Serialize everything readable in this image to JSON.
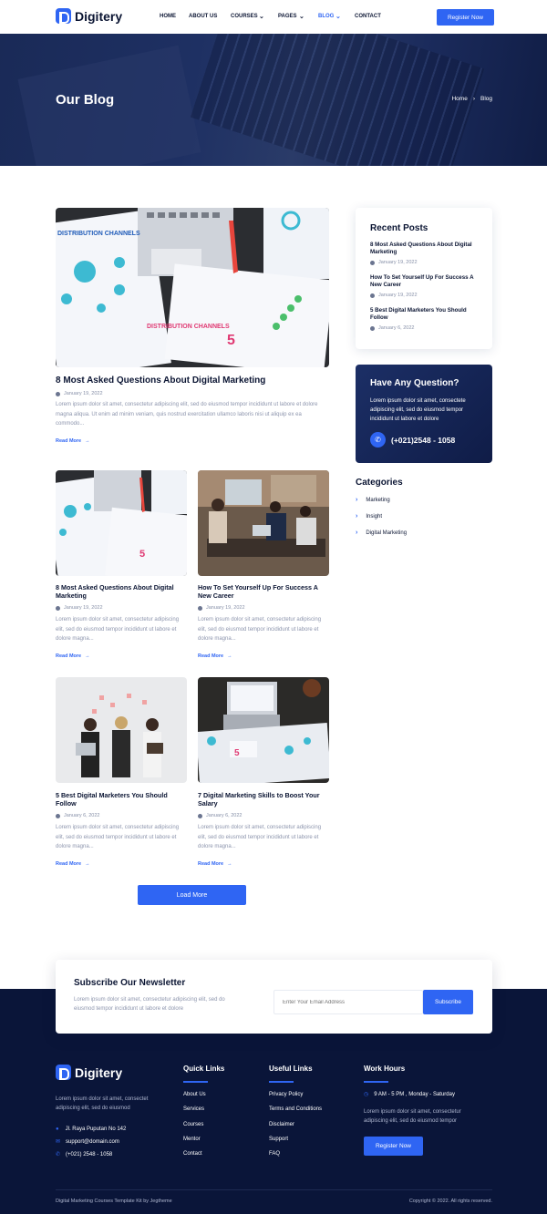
{
  "brand": {
    "name": "Digitery"
  },
  "nav": {
    "items": [
      "HOME",
      "ABOUT US",
      "COURSES",
      "PAGES",
      "BLOG",
      "CONTACT"
    ],
    "cta": "Register Now"
  },
  "hero": {
    "title": "Our Blog",
    "crumb_home": "Home",
    "crumb_current": "Blog"
  },
  "featured": {
    "title": "8 Most Asked Questions About Digital Marketing",
    "date": "January 19, 2022",
    "excerpt": "Lorem ipsum dolor sit amet, consectetur adipiscing elit, sed do eiusmod tempor incididunt ut labore et dolore magna aliqua. Ut enim ad minim veniam, quis nostrud exercitation ullamco laboris nisi ut aliquip ex ea commodo...",
    "read_more": "Read More"
  },
  "posts": [
    {
      "title": "8 Most Asked Questions About Digital Marketing",
      "date": "January 19, 2022",
      "excerpt": "Lorem ipsum dolor sit amet, consectetur adipiscing elit, sed do eiusmod tempor incididunt ut labore et dolore magna...",
      "read_more": "Read More"
    },
    {
      "title": "How To Set Yourself Up For Success A New Career",
      "date": "January 19, 2022",
      "excerpt": "Lorem ipsum dolor sit amet, consectetur adipiscing elit, sed do eiusmod tempor incididunt ut labore et dolore magna...",
      "read_more": "Read More"
    },
    {
      "title": "5 Best Digital Marketers You Should Follow",
      "date": "January 6, 2022",
      "excerpt": "Lorem ipsum dolor sit amet, consectetur adipiscing elit, sed do eiusmod tempor incididunt ut labore et dolore magna...",
      "read_more": "Read More"
    },
    {
      "title": "7 Digital Marketing Skills to Boost Your Salary",
      "date": "January 6, 2022",
      "excerpt": "Lorem ipsum dolor sit amet, consectetur adipiscing elit, sed do eiusmod tempor incididunt ut labore et dolore magna...",
      "read_more": "Read More"
    }
  ],
  "load_more": "Load More",
  "sidebar": {
    "recent_title": "Recent Posts",
    "recent": [
      {
        "title": "8 Most Asked Questions About Digital Marketing",
        "date": "January 19, 2022"
      },
      {
        "title": "How To Set Yourself Up For Success A New Career",
        "date": "January 19, 2022"
      },
      {
        "title": "5 Best Digital Marketers You Should Follow",
        "date": "January 6, 2022"
      }
    ],
    "question_title": "Have Any Question?",
    "question_text": "Lorem ipsum dolor sit amet, consectete adipiscing elit, sed do eiusmod tempor incididunt ut labore et dolore",
    "phone": "(+021)2548 - 1058",
    "categories_title": "Categories",
    "categories": [
      "Marketing",
      "Insight",
      "Digital Marketing"
    ]
  },
  "newsletter": {
    "title": "Subscribe Our Newsletter",
    "text": "Lorem ipsum dolor sit amet, consectetur adipiscing elit, sed do eiusmod tempor incididunt ut labore et dolore",
    "placeholder": "Enter Your Email Address",
    "button": "Subscribe"
  },
  "footer": {
    "about": "Lorem ipsum dolor sit amet, consectet adipiscing elit, sed do eiusmod",
    "address": "Jl. Raya Puputan No 142",
    "email": "support@domain.com",
    "phone": "(+021) 2548 - 1058",
    "quick_title": "Quick Links",
    "quick_links": [
      "About Us",
      "Services",
      "Courses",
      "Mentor",
      "Contact"
    ],
    "useful_title": "Useful Links",
    "useful_links": [
      "Privacy Policy",
      "Terms and Conditions",
      "Disclaimer",
      "Support",
      "FAQ"
    ],
    "hours_title": "Work Hours",
    "hours": "9 AM - 5 PM , Monday - Saturday",
    "hours_text": "Lorem ipsum dolor sit amet, consectetur adipiscing elit, sed do eiusmod tempor",
    "register": "Register Now",
    "credit": "Digital Marketing Courses Template Kit by Jegtheme",
    "copyright": "Copyright © 2022. All rights reserved."
  },
  "colors": {
    "accent": "#2f65f3",
    "navy": "#0a1539",
    "text": "#0b1533"
  }
}
